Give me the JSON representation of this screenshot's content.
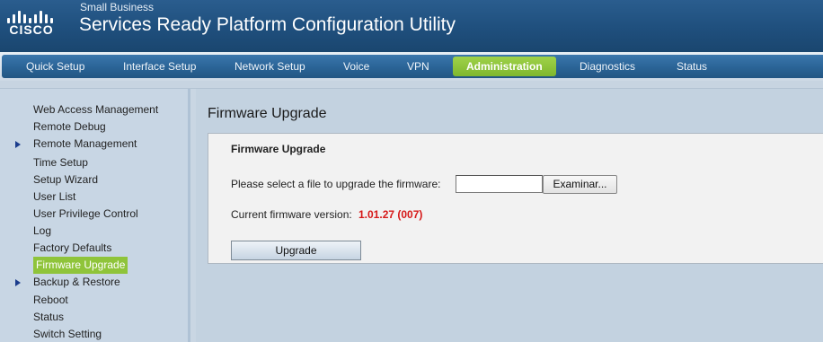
{
  "header": {
    "logo_text": "CISCO",
    "sub_brand": "Small Business",
    "title": "Services Ready Platform Configuration Utility"
  },
  "nav": {
    "items": [
      {
        "label": "Quick Setup"
      },
      {
        "label": "Interface Setup"
      },
      {
        "label": "Network Setup"
      },
      {
        "label": "Voice"
      },
      {
        "label": "VPN"
      },
      {
        "label": "Administration",
        "active": true
      },
      {
        "label": "Diagnostics"
      },
      {
        "label": "Status"
      }
    ]
  },
  "sidebar": {
    "items": [
      {
        "label": "Web Access Management"
      },
      {
        "label": "Remote Debug"
      },
      {
        "label": "Remote Management",
        "expandable": true
      },
      {
        "label": "Time Setup"
      },
      {
        "label": "Setup Wizard"
      },
      {
        "label": "User List"
      },
      {
        "label": "User Privilege Control"
      },
      {
        "label": "Log"
      },
      {
        "label": "Factory Defaults"
      },
      {
        "label": "Firmware Upgrade",
        "active": true
      },
      {
        "label": "Backup & Restore",
        "expandable": true
      },
      {
        "label": "Reboot"
      },
      {
        "label": "Status"
      },
      {
        "label": "Switch Setting"
      }
    ]
  },
  "main": {
    "page_title": "Firmware Upgrade",
    "panel_title": "Firmware Upgrade",
    "file_label": "Please select a file to upgrade the firmware:",
    "file_value": "",
    "browse_label": "Examinar...",
    "fw_label": "Current firmware version:",
    "fw_value": "1.01.27 (007)",
    "upgrade_label": "Upgrade"
  },
  "colors": {
    "accent": "#8fc43a",
    "header": "#1f4f7d",
    "firmware_version": "#d61818"
  },
  "icons": {
    "logo": "cisco-logo-icon",
    "expand": "triangle-right-icon"
  }
}
